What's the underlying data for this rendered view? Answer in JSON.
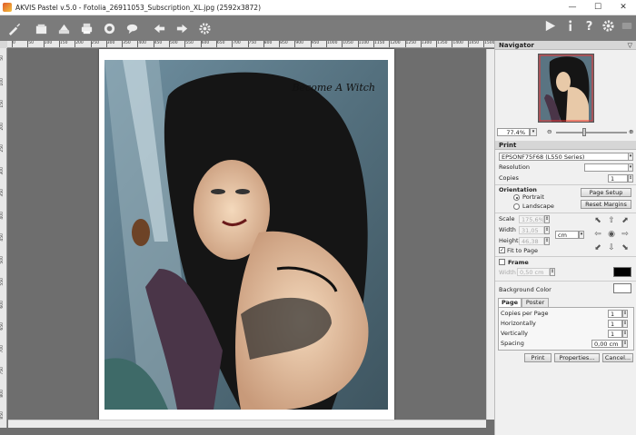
{
  "window": {
    "title": "AKVIS Pastel v.5.0 - Fotolia_26911053_Subscription_XL.jpg (2592x3872)",
    "minimize": "—",
    "maximize": "☐",
    "close": "✕"
  },
  "toolbar": {
    "left_icons": [
      "brush-icon",
      "open-icon",
      "save-icon",
      "print-icon",
      "share-icon",
      "comment-icon",
      "undo-icon",
      "redo-icon",
      "settings-gear-icon"
    ],
    "right_icons": [
      "run-icon",
      "info-icon",
      "help-icon",
      "settings-icon",
      "chat-icon"
    ]
  },
  "ruler": {
    "top_marks": [
      "0",
      "50",
      "100",
      "150",
      "200",
      "250",
      "300",
      "350",
      "400",
      "450",
      "500",
      "550",
      "600",
      "650",
      "700",
      "750",
      "800",
      "850",
      "900",
      "950",
      "1000",
      "1050",
      "1100",
      "1150",
      "1200",
      "1250",
      "1300",
      "1350",
      "1400",
      "1450",
      "1500"
    ],
    "left_marks": [
      "50",
      "100",
      "150",
      "200",
      "250",
      "300",
      "350",
      "400",
      "450",
      "500",
      "550",
      "600",
      "650",
      "700",
      "750",
      "800",
      "850"
    ]
  },
  "canvas": {
    "caption": "Become A Witch"
  },
  "navigator": {
    "header": "Navigator",
    "zoom": "77.4%",
    "zoom_out": "⊖",
    "zoom_in": "⊕"
  },
  "print": {
    "header": "Print",
    "printer": "EPSONF75F68 (L550 Series)",
    "resolution_label": "Resolution",
    "resolution_value": "",
    "copies_label": "Copies",
    "copies_value": "1",
    "orientation_label": "Orientation",
    "portrait_label": "Portrait",
    "landscape_label": "Landscape",
    "page_setup_button": "Page Setup",
    "reset_margins_button": "Reset Margins",
    "scale_label": "Scale",
    "scale_value": "175,6%",
    "width_label": "Width",
    "width_value": "31,05",
    "height_label": "Height",
    "height_value": "46,38",
    "unit": "cm",
    "fit_to_page_label": "Fit to Page",
    "frame_label": "Frame",
    "frame_width_label": "Width",
    "frame_width_value": "0,50 cm",
    "frame_color": "#000000",
    "background_color_label": "Background Color",
    "background_color": "#ffffff",
    "tabs": [
      "Page",
      "Poster"
    ],
    "copies_per_page_label": "Copies per Page",
    "copies_per_page_value": "1",
    "horizontally_label": "Horizontally",
    "horizontally_value": "1",
    "vertically_label": "Vertically",
    "vertically_value": "1",
    "spacing_label": "Spacing",
    "spacing_value": "0,00 cm",
    "print_button": "Print",
    "properties_button": "Properties...",
    "cancel_button": "Cancel..."
  }
}
